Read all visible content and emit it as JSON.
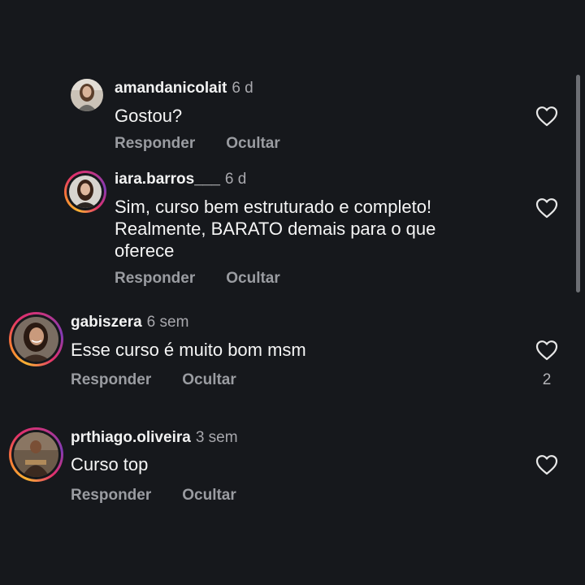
{
  "colors": {
    "background": "#16181c",
    "text": "#f2f2f2",
    "muted": "#9a9ca1",
    "story_ring": [
      "#f9b233",
      "#e1306c",
      "#833ab4"
    ]
  },
  "icons": {
    "like": "heart-outline-icon"
  },
  "comments": [
    {
      "username": "amandanicolait",
      "time": "6 d",
      "text": "Gostou?",
      "reply_label": "Responder",
      "hide_label": "Ocultar",
      "likes": "",
      "is_reply": true,
      "story_ring": false
    },
    {
      "username": "iara.barros___",
      "time": "6 d",
      "text_lines": [
        "Sim, curso bem estruturado e completo!",
        "Realmente, BARATO demais para o que",
        "oferece"
      ],
      "reply_label": "Responder",
      "hide_label": "Ocultar",
      "likes": "",
      "is_reply": true,
      "story_ring": true
    },
    {
      "username": "gabiszera",
      "time": "6 sem",
      "text": "Esse curso é muito bom msm",
      "reply_label": "Responder",
      "hide_label": "Ocultar",
      "likes": "2",
      "is_reply": false,
      "story_ring": true
    },
    {
      "username": "prthiago.oliveira",
      "time": "3 sem",
      "text": "Curso top",
      "reply_label": "Responder",
      "hide_label": "Ocultar",
      "likes": "",
      "is_reply": false,
      "story_ring": true
    }
  ]
}
